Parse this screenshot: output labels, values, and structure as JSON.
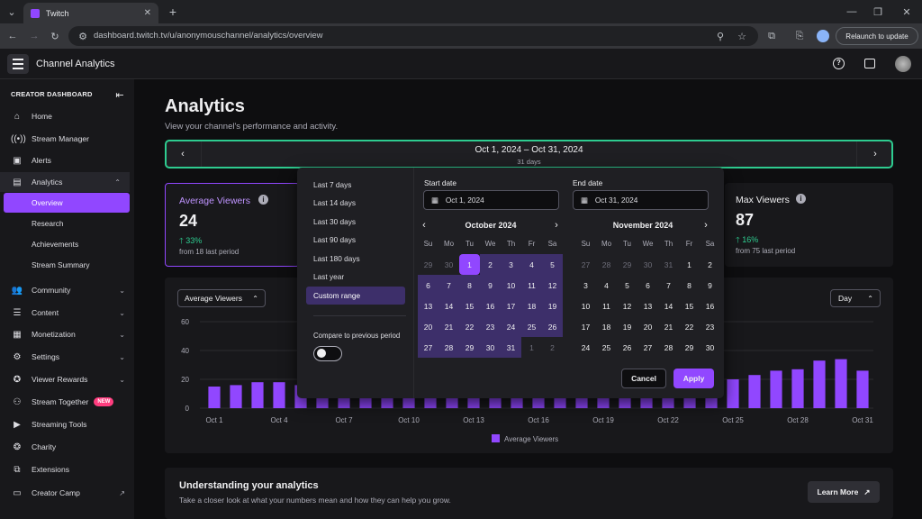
{
  "browser": {
    "tab_title": "Twitch",
    "url": "dashboard.twitch.tv/u/anonymouschannel/analytics/overview",
    "relaunch": "Relaunch to update"
  },
  "header": {
    "title": "Channel Analytics"
  },
  "sidebar": {
    "heading": "CREATOR DASHBOARD",
    "items": [
      {
        "label": "Home",
        "icon": "home-icon"
      },
      {
        "label": "Stream Manager",
        "icon": "broadcast-icon"
      },
      {
        "label": "Alerts",
        "icon": "alert-icon"
      },
      {
        "label": "Analytics",
        "icon": "analytics-icon"
      },
      {
        "label": "Community",
        "icon": "community-icon"
      },
      {
        "label": "Content",
        "icon": "content-icon"
      },
      {
        "label": "Monetization",
        "icon": "monetization-icon"
      },
      {
        "label": "Settings",
        "icon": "settings-icon"
      },
      {
        "label": "Viewer Rewards",
        "icon": "rewards-icon"
      },
      {
        "label": "Stream Together",
        "icon": "stream-together-icon",
        "badge": "NEW"
      },
      {
        "label": "Streaming Tools",
        "icon": "tools-icon"
      },
      {
        "label": "Charity",
        "icon": "charity-icon"
      },
      {
        "label": "Extensions",
        "icon": "extensions-icon"
      },
      {
        "label": "Creator Camp",
        "icon": "camp-icon"
      }
    ],
    "analytics_sub": [
      "Overview",
      "Research",
      "Achievements",
      "Stream Summary"
    ]
  },
  "main": {
    "title": "Analytics",
    "subtitle": "View your channel's performance and activity.",
    "range": {
      "label": "Oct 1, 2024 – Oct 31, 2024",
      "days": "31 days"
    },
    "stats": [
      {
        "title": "Average Viewers",
        "value": "24",
        "change": "33%",
        "from": "from 18 last period"
      },
      {
        "title": "Max Viewers",
        "value": "87",
        "change": "16%",
        "from": "from 75 last period"
      }
    ],
    "metric_select": "Average Viewers",
    "interval_select": "Day",
    "learn": {
      "title": "Understanding your analytics",
      "desc": "Take a closer look at what your numbers mean and how they can help you grow.",
      "button": "Learn More"
    }
  },
  "picker": {
    "quick": [
      "Last 7 days",
      "Last 14 days",
      "Last 30 days",
      "Last 90 days",
      "Last 180 days",
      "Last year",
      "Custom range"
    ],
    "compare": "Compare to previous period",
    "start_label": "Start date",
    "start_value": "Oct 1, 2024",
    "end_label": "End date",
    "end_value": "Oct 31, 2024",
    "month1": "October 2024",
    "month2": "November 2024",
    "weekdays": [
      "Su",
      "Mo",
      "Tu",
      "We",
      "Th",
      "Fr",
      "Sa"
    ],
    "cancel": "Cancel",
    "apply": "Apply"
  },
  "chart_data": {
    "type": "bar",
    "x": [
      "Oct 1",
      "Oct 2",
      "Oct 3",
      "Oct 4",
      "Oct 5",
      "Oct 6",
      "Oct 7",
      "Oct 8",
      "Oct 9",
      "Oct 10",
      "Oct 11",
      "Oct 12",
      "Oct 13",
      "Oct 14",
      "Oct 15",
      "Oct 16",
      "Oct 17",
      "Oct 18",
      "Oct 19",
      "Oct 20",
      "Oct 21",
      "Oct 22",
      "Oct 23",
      "Oct 24",
      "Oct 25",
      "Oct 26",
      "Oct 27",
      "Oct 28",
      "Oct 29",
      "Oct 30",
      "Oct 31"
    ],
    "tick_labels": [
      "Oct 1",
      "Oct 4",
      "Oct 7",
      "Oct 10",
      "Oct 13",
      "Oct 16",
      "Oct 19",
      "Oct 22",
      "Oct 25",
      "Oct 28",
      "Oct 31"
    ],
    "series": [
      {
        "name": "Average Viewers",
        "values": [
          15,
          16,
          18,
          18,
          16,
          16,
          16,
          16,
          16,
          16,
          16,
          16,
          16,
          16,
          16,
          16,
          16,
          16,
          16,
          16,
          16,
          16,
          16,
          16,
          20,
          23,
          26,
          27,
          33,
          34,
          26
        ],
        "color": "#9147ff"
      }
    ],
    "yticks": [
      0,
      20,
      40,
      60
    ],
    "ylim": [
      0,
      60
    ],
    "legend": "bottom"
  }
}
